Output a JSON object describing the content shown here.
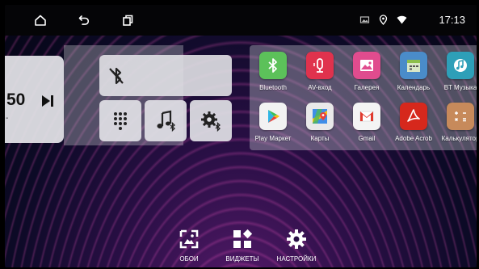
{
  "status_bar": {
    "nav": [
      {
        "name": "home-icon"
      },
      {
        "name": "back-icon"
      },
      {
        "name": "recent-apps-icon"
      }
    ],
    "icons": [
      "image-icon",
      "location-icon",
      "wifi-icon"
    ],
    "time": "17:13"
  },
  "media_widget": {
    "time_fragment": "50",
    "dash": "-",
    "next_icon": "skip-next-icon"
  },
  "quick_widgets": {
    "bluetooth_icon": "bluetooth-off-icon",
    "buttons": [
      {
        "name": "dialpad-icon"
      },
      {
        "name": "bt-music-icon"
      },
      {
        "name": "bt-settings-icon"
      }
    ]
  },
  "apps": [
    {
      "label": "Bluetooth",
      "color": "#5cc15a"
    },
    {
      "label": "AV-вход",
      "color": "#e0324d"
    },
    {
      "label": "Галерея",
      "color": "#e04c8e"
    },
    {
      "label": "Календарь",
      "color": "#4a8cc9"
    },
    {
      "label": "BT Музыка",
      "color": "#2e9fb8"
    },
    {
      "label": "Play Маркет",
      "color": "#f2f2f2"
    },
    {
      "label": "Карты",
      "color": "#e9e9e9"
    },
    {
      "label": "Gmail",
      "color": "#f4f4f4"
    },
    {
      "label": "Adobe Acrob",
      "color": "#d6281c"
    },
    {
      "label": "Калькулятор",
      "color": "#c78a5b"
    }
  ],
  "bottom": {
    "wallpaper": "ОБОИ",
    "widgets": "ВИДЖЕТЫ",
    "settings": "НАСТРОЙКИ"
  },
  "colors": {
    "statusbar_bg": "#050507",
    "accent_magenta": "#b84ad6"
  }
}
